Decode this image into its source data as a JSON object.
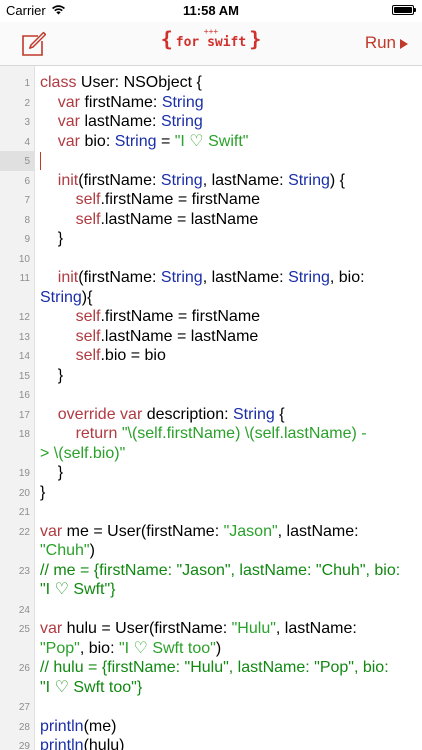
{
  "status_bar": {
    "carrier": "Carrier",
    "time": "11:58 AM",
    "battery_percent": 100
  },
  "nav": {
    "compose_icon": "compose-icon",
    "logo_braces_left": "{",
    "logo_plus": "+++",
    "logo_text": "for swift",
    "logo_braces_right": "}",
    "run_label": "Run",
    "run_icon": "play-triangle-icon",
    "accent_color": "#c0392b"
  },
  "editor": {
    "active_line": 5,
    "lines": [
      {
        "n": "1",
        "tokens": [
          [
            "k",
            "class"
          ],
          [
            "p",
            " User: NSObject {"
          ]
        ]
      },
      {
        "n": "2",
        "tokens": [
          [
            "p",
            "    "
          ],
          [
            "k",
            "var"
          ],
          [
            "p",
            " firstName: "
          ],
          [
            "t",
            "String"
          ]
        ]
      },
      {
        "n": "3",
        "tokens": [
          [
            "p",
            "    "
          ],
          [
            "k",
            "var"
          ],
          [
            "p",
            " lastName: "
          ],
          [
            "t",
            "String"
          ]
        ]
      },
      {
        "n": "4",
        "tokens": [
          [
            "p",
            "    "
          ],
          [
            "k",
            "var"
          ],
          [
            "p",
            " bio: "
          ],
          [
            "t",
            "String"
          ],
          [
            "p",
            " = "
          ],
          [
            "s",
            "\"I ♡ Swift\""
          ]
        ]
      },
      {
        "n": "5",
        "tokens": []
      },
      {
        "n": "6",
        "tokens": [
          [
            "p",
            "    "
          ],
          [
            "k",
            "init"
          ],
          [
            "p",
            "(firstName: "
          ],
          [
            "t",
            "String"
          ],
          [
            "p",
            ", lastName: "
          ],
          [
            "t",
            "String"
          ],
          [
            "p",
            ") {"
          ]
        ]
      },
      {
        "n": "7",
        "tokens": [
          [
            "p",
            "        "
          ],
          [
            "k",
            "self"
          ],
          [
            "p",
            ".firstName = firstName"
          ]
        ]
      },
      {
        "n": "8",
        "tokens": [
          [
            "p",
            "        "
          ],
          [
            "k",
            "self"
          ],
          [
            "p",
            ".lastName = lastName"
          ]
        ]
      },
      {
        "n": "9",
        "tokens": [
          [
            "p",
            "    }"
          ]
        ]
      },
      {
        "n": "10",
        "tokens": []
      },
      {
        "n": "11",
        "tokens": [
          [
            "p",
            "    "
          ],
          [
            "k",
            "init"
          ],
          [
            "p",
            "(firstName: "
          ],
          [
            "t",
            "String"
          ],
          [
            "p",
            ", lastName: "
          ],
          [
            "t",
            "String"
          ],
          [
            "p",
            ", bio:"
          ]
        ]
      },
      {
        "n": "",
        "tokens": [
          [
            "t",
            "String"
          ],
          [
            "p",
            "){"
          ]
        ]
      },
      {
        "n": "12",
        "tokens": [
          [
            "p",
            "        "
          ],
          [
            "k",
            "self"
          ],
          [
            "p",
            ".firstName = firstName"
          ]
        ]
      },
      {
        "n": "13",
        "tokens": [
          [
            "p",
            "        "
          ],
          [
            "k",
            "self"
          ],
          [
            "p",
            ".lastName = lastName"
          ]
        ]
      },
      {
        "n": "14",
        "tokens": [
          [
            "p",
            "        "
          ],
          [
            "k",
            "self"
          ],
          [
            "p",
            ".bio = bio"
          ]
        ]
      },
      {
        "n": "15",
        "tokens": [
          [
            "p",
            "    }"
          ]
        ]
      },
      {
        "n": "16",
        "tokens": []
      },
      {
        "n": "17",
        "tokens": [
          [
            "p",
            "    "
          ],
          [
            "k",
            "override"
          ],
          [
            "p",
            " "
          ],
          [
            "k",
            "var"
          ],
          [
            "p",
            " description: "
          ],
          [
            "t",
            "String"
          ],
          [
            "p",
            " {"
          ]
        ]
      },
      {
        "n": "18",
        "tokens": [
          [
            "p",
            "        "
          ],
          [
            "k",
            "return"
          ],
          [
            "p",
            " "
          ],
          [
            "s",
            "\"\\(self.firstName) \\(self.lastName) -"
          ]
        ]
      },
      {
        "n": "",
        "tokens": [
          [
            "s",
            "> \\(self.bio)\""
          ]
        ]
      },
      {
        "n": "19",
        "tokens": [
          [
            "p",
            "    }"
          ]
        ]
      },
      {
        "n": "20",
        "tokens": [
          [
            "p",
            "}"
          ]
        ]
      },
      {
        "n": "21",
        "tokens": []
      },
      {
        "n": "22",
        "tokens": [
          [
            "k",
            "var"
          ],
          [
            "p",
            " me = User(firstName: "
          ],
          [
            "s",
            "\"Jason\""
          ],
          [
            "p",
            ", lastName:"
          ]
        ]
      },
      {
        "n": "",
        "tokens": [
          [
            "s",
            "\"Chuh\""
          ],
          [
            "p",
            ")"
          ]
        ]
      },
      {
        "n": "23",
        "tokens": [
          [
            "c",
            "// me = {firstName: \"Jason\", lastName: \"Chuh\", bio:"
          ]
        ]
      },
      {
        "n": "",
        "tokens": [
          [
            "c",
            "\"I ♡ Swft\"}"
          ]
        ]
      },
      {
        "n": "24",
        "tokens": []
      },
      {
        "n": "25",
        "tokens": [
          [
            "k",
            "var"
          ],
          [
            "p",
            " hulu = User(firstName: "
          ],
          [
            "s",
            "\"Hulu\""
          ],
          [
            "p",
            ", lastName:"
          ]
        ]
      },
      {
        "n": "",
        "tokens": [
          [
            "s",
            "\"Pop\""
          ],
          [
            "p",
            ", bio: "
          ],
          [
            "s",
            "\"I ♡ Swft too\""
          ],
          [
            "p",
            ")"
          ]
        ]
      },
      {
        "n": "26",
        "tokens": [
          [
            "c",
            "// hulu = {firstName: \"Hulu\", lastName: \"Pop\", bio:"
          ]
        ]
      },
      {
        "n": "",
        "tokens": [
          [
            "c",
            "\"I ♡ Swft too\"}"
          ]
        ]
      },
      {
        "n": "27",
        "tokens": []
      },
      {
        "n": "28",
        "tokens": [
          [
            "t",
            "println"
          ],
          [
            "p",
            "(me)"
          ]
        ]
      },
      {
        "n": "29",
        "tokens": [
          [
            "t",
            "println"
          ],
          [
            "p",
            "(hulu)"
          ]
        ]
      }
    ]
  }
}
